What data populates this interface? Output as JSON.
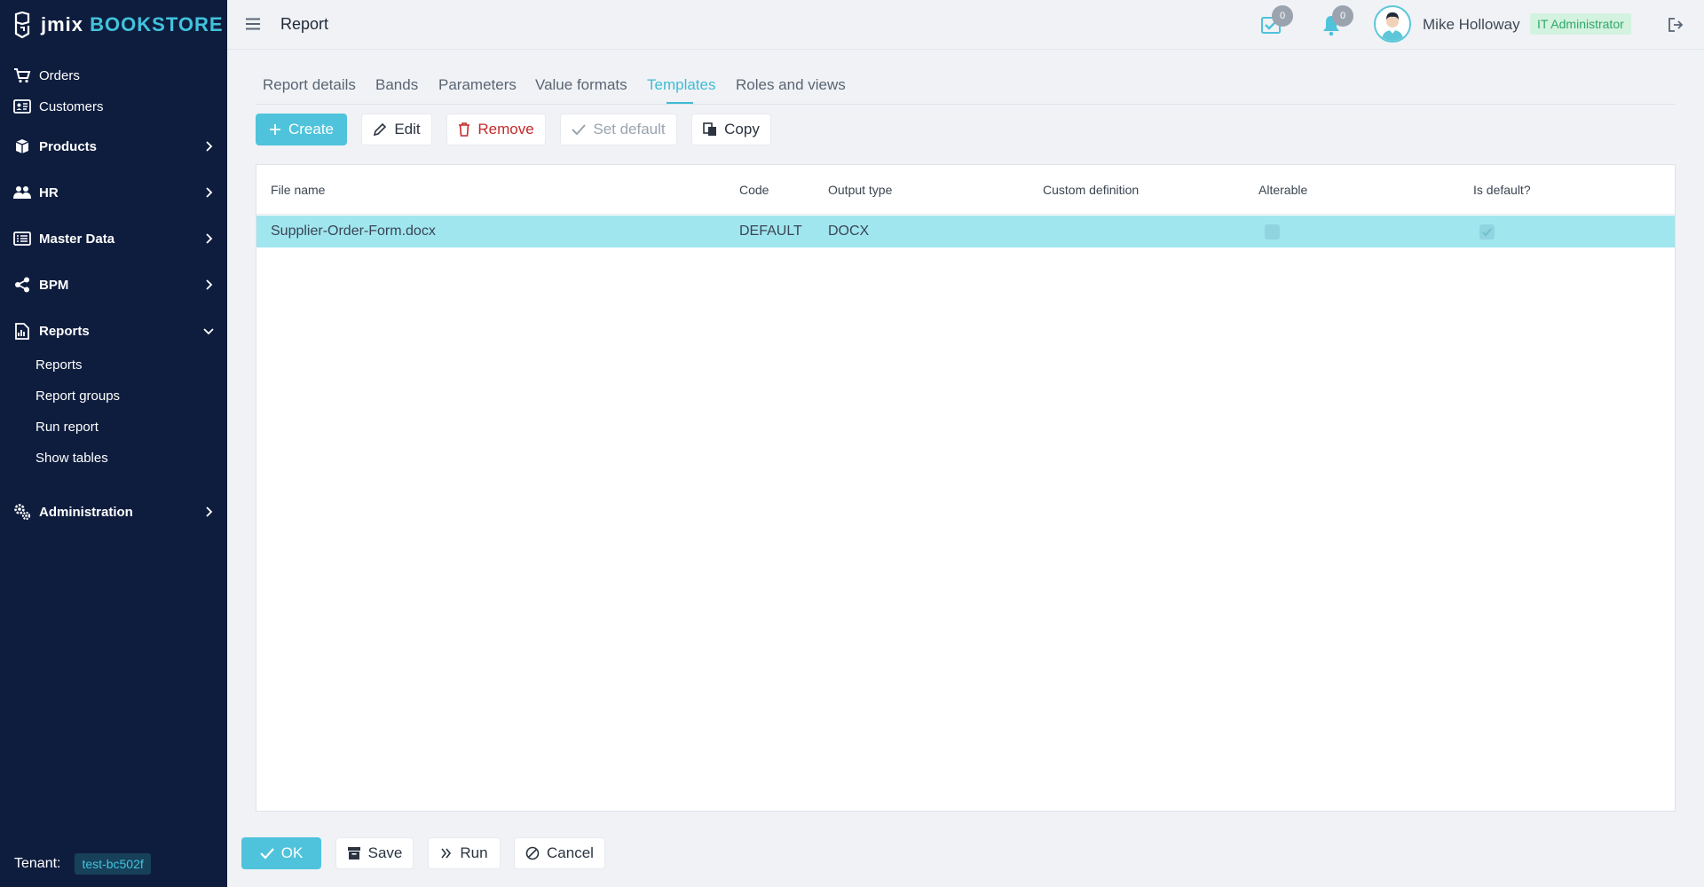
{
  "app": {
    "logo_jmix": "jmix",
    "logo_bookstore": "BOOKSTORE"
  },
  "sidebar": {
    "items": [
      {
        "label": "Orders",
        "icon": "cart-icon"
      },
      {
        "label": "Customers",
        "icon": "id-card-icon"
      },
      {
        "label": "Products",
        "icon": "box-icon"
      },
      {
        "label": "HR",
        "icon": "users-icon"
      },
      {
        "label": "Master Data",
        "icon": "list-icon"
      },
      {
        "label": "BPM",
        "icon": "share-icon"
      },
      {
        "label": "Reports",
        "icon": "file-chart-icon"
      },
      {
        "label": "Administration",
        "icon": "gears-icon"
      }
    ],
    "reports_sub": [
      "Reports",
      "Report groups",
      "Run report",
      "Show tables"
    ],
    "tenant_label": "Tenant:",
    "tenant_value": "test-bc502f"
  },
  "header": {
    "title": "Report",
    "tasks_count": "0",
    "notifications_count": "0",
    "user_name": "Mike Holloway",
    "user_role": "IT Administrator"
  },
  "tabs": [
    "Report details",
    "Bands",
    "Parameters",
    "Value formats",
    "Templates",
    "Roles and views"
  ],
  "active_tab": "Templates",
  "toolbar": {
    "create": "Create",
    "edit": "Edit",
    "remove": "Remove",
    "set_default": "Set default",
    "copy": "Copy"
  },
  "grid": {
    "columns": [
      "File name",
      "Code",
      "Output type",
      "Custom definition",
      "Alterable",
      "Is default?"
    ],
    "rows": [
      {
        "file_name": "Supplier-Order-Form.docx",
        "code": "DEFAULT",
        "output_type": "DOCX",
        "custom_definition": "",
        "alterable": false,
        "is_default": true
      }
    ]
  },
  "footer": {
    "ok": "OK",
    "save": "Save",
    "run": "Run",
    "cancel": "Cancel"
  },
  "colors": {
    "sidebar_bg": "#0e1d3e",
    "accent": "#4fc3db",
    "selected_row": "#a0e6ef",
    "danger": "#c42a2a"
  }
}
